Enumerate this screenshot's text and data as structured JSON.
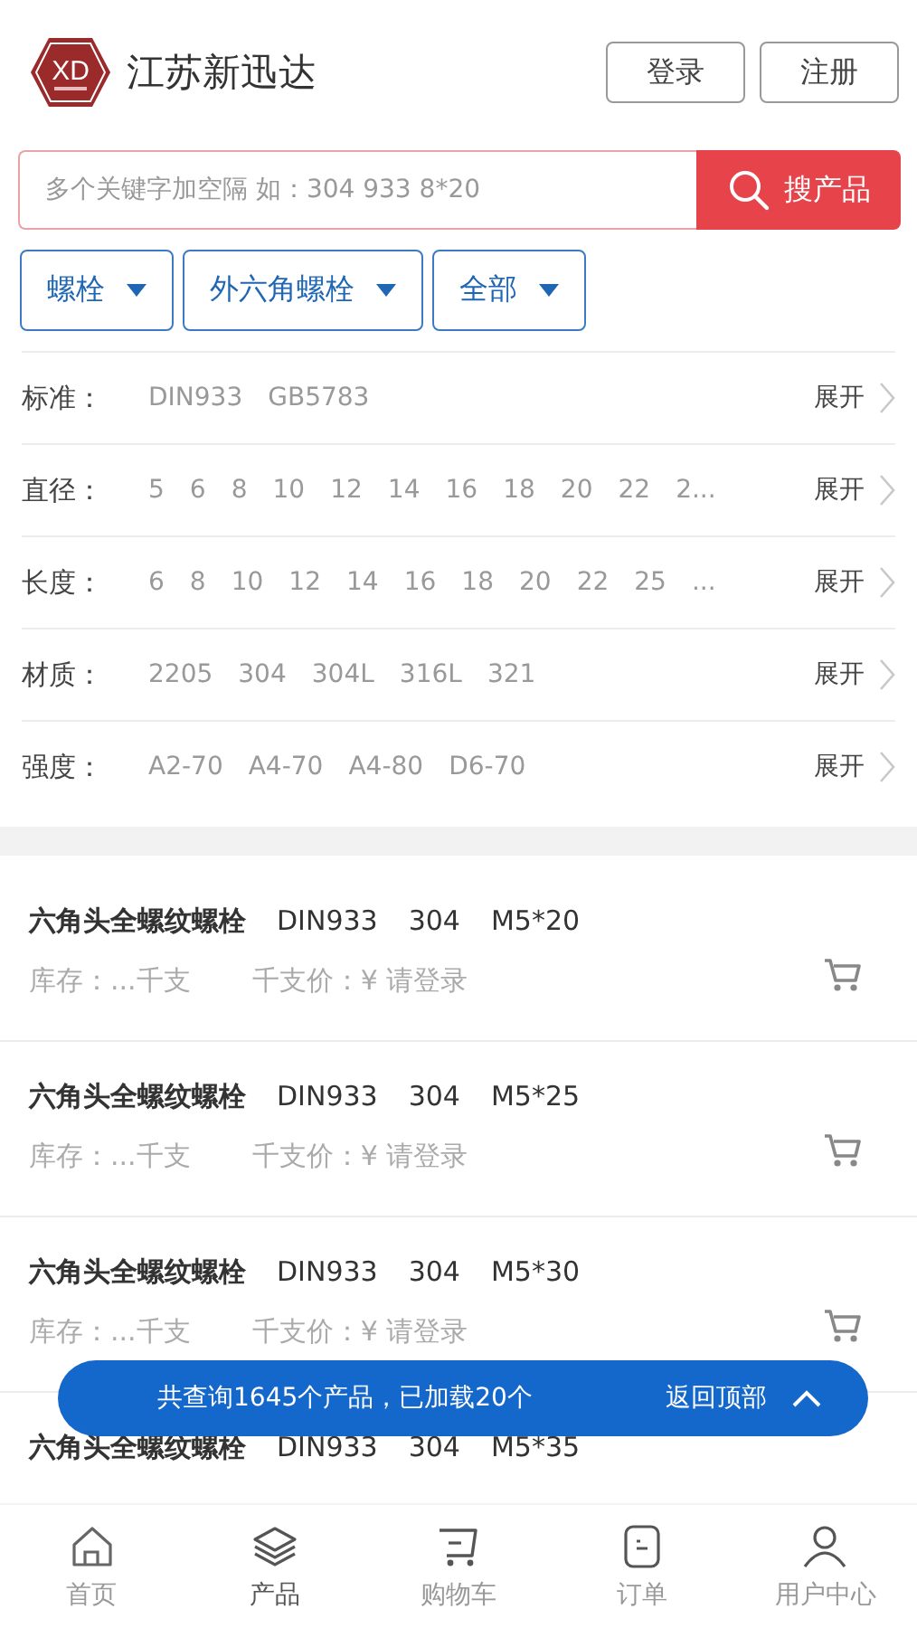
{
  "header": {
    "logo_text": "XD",
    "brand": "江苏新迅达",
    "buttons": [
      "登录",
      "注册"
    ]
  },
  "search": {
    "placeholder": "多个关键字加空隔 如：304 933 8*20",
    "button": "搜产品"
  },
  "dropdowns": [
    "螺栓",
    "外六角螺栓",
    "全部"
  ],
  "filters": [
    {
      "label": "标准：",
      "values": [
        "DIN933",
        "GB5783"
      ],
      "toggle": "展开"
    },
    {
      "label": "直径：",
      "values": [
        "5",
        "6",
        "8",
        "10",
        "12",
        "14",
        "16",
        "18",
        "20",
        "22",
        "2..."
      ],
      "toggle": "展开"
    },
    {
      "label": "长度：",
      "values": [
        "6",
        "8",
        "10",
        "12",
        "14",
        "16",
        "18",
        "20",
        "22",
        "25",
        "..."
      ],
      "toggle": "展开"
    },
    {
      "label": "材质：",
      "values": [
        "2205",
        "304",
        "304L",
        "316L",
        "321"
      ],
      "toggle": "展开"
    },
    {
      "label": "强度：",
      "values": [
        "A2-70",
        "A4-70",
        "A4-80",
        "D6-70"
      ],
      "toggle": "展开"
    }
  ],
  "products": [
    {
      "name": "六角头全螺纹螺栓",
      "standard": "DIN933",
      "material": "304",
      "size": "M5*20",
      "stock": "库存：...千支",
      "price": "千支价：¥ 请登录"
    },
    {
      "name": "六角头全螺纹螺栓",
      "standard": "DIN933",
      "material": "304",
      "size": "M5*25",
      "stock": "库存：...千支",
      "price": "千支价：¥ 请登录"
    },
    {
      "name": "六角头全螺纹螺栓",
      "standard": "DIN933",
      "material": "304",
      "size": "M5*30",
      "stock": "库存：...千支",
      "price": "千支价：¥ 请登录"
    },
    {
      "name": "六角头全螺纹螺栓",
      "standard": "DIN933",
      "material": "304",
      "size": "M5*35"
    }
  ],
  "load_bar": {
    "summary": "共查询1645个产品，已加载20个",
    "back_to_top": "返回顶部"
  },
  "bottom_nav": [
    {
      "kind": "home",
      "label": "首页",
      "selected": false
    },
    {
      "kind": "layers",
      "label": "产品",
      "selected": true
    },
    {
      "kind": "cart",
      "label": "购物车",
      "selected": false
    },
    {
      "kind": "order",
      "label": "订单",
      "selected": false
    },
    {
      "kind": "user",
      "label": "用户中心",
      "selected": false
    }
  ]
}
